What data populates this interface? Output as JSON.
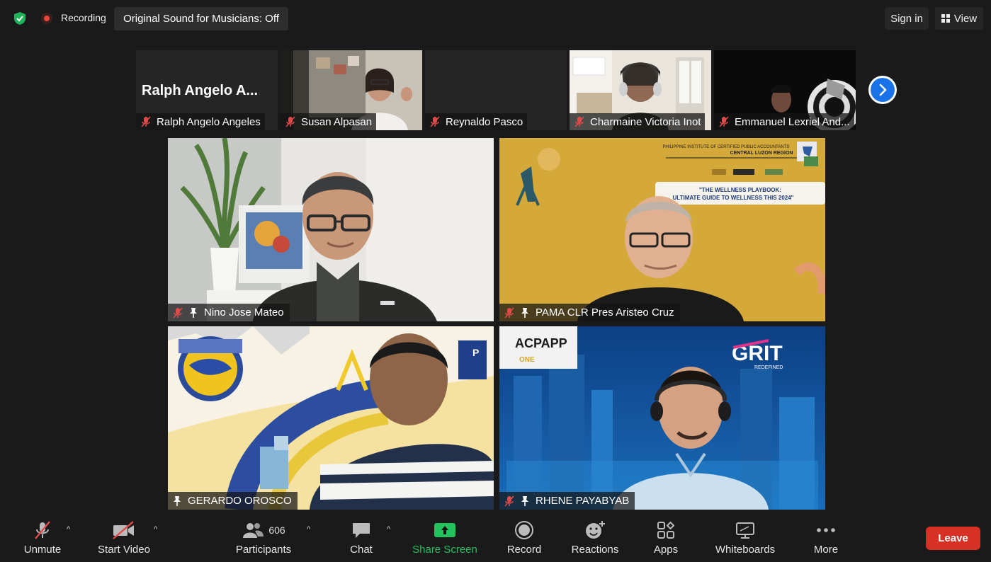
{
  "topbar": {
    "recording_label": "Recording",
    "original_sound_label": "Original Sound for Musicians: Off",
    "sign_in_label": "Sign in",
    "view_label": "View"
  },
  "strip": {
    "tiles": [
      {
        "name": "Ralph Angelo Angeles",
        "display_text": "Ralph Angelo A...",
        "muted": true
      },
      {
        "name": "Susan Alpasan",
        "muted": true
      },
      {
        "name": "Reynaldo Pasco",
        "muted": true
      },
      {
        "name": "Charmaine Victoria Inot",
        "muted": true
      },
      {
        "name": "Emmanuel Lexriel And...",
        "muted": true
      }
    ],
    "next_icon": "chevron-right-icon"
  },
  "videos": [
    {
      "name": "Nino Jose Mateo",
      "muted": true,
      "pinned": true
    },
    {
      "name": "PAMA CLR Pres Aristeo Cruz",
      "muted": true,
      "pinned": true,
      "slide": {
        "header1": "PHILIPPINE INSTITUTE OF CERTIFIED PUBLIC ACCOUNTANTS",
        "header2": "CENTRAL LUZON REGION",
        "title1": "\"THE WELLNESS PLAYBOOK:",
        "title2": "ULTIMATE GUIDE TO WELLNESS THIS 2024\""
      }
    },
    {
      "name": "GERARDO OROSCO",
      "muted": false,
      "pinned": true
    },
    {
      "name": "RHENE PAYABYAB",
      "muted": true,
      "pinned": true,
      "background": {
        "logo1": "ACPAPP",
        "logo2": "ONE",
        "brand": "GRIT",
        "brand_sub": "REDEFINED"
      }
    }
  ],
  "toolbar": {
    "unmute_label": "Unmute",
    "start_video_label": "Start Video",
    "participants_label": "Participants",
    "participants_count": "606",
    "chat_label": "Chat",
    "share_screen_label": "Share Screen",
    "record_label": "Record",
    "reactions_label": "Reactions",
    "apps_label": "Apps",
    "whiteboards_label": "Whiteboards",
    "more_label": "More",
    "leave_label": "Leave"
  },
  "colors": {
    "background": "#1a1a1a",
    "accent_green": "#22c25f",
    "mute_red": "#e04a4a",
    "leave_red": "#d93025",
    "next_blue": "#1a72e8"
  }
}
